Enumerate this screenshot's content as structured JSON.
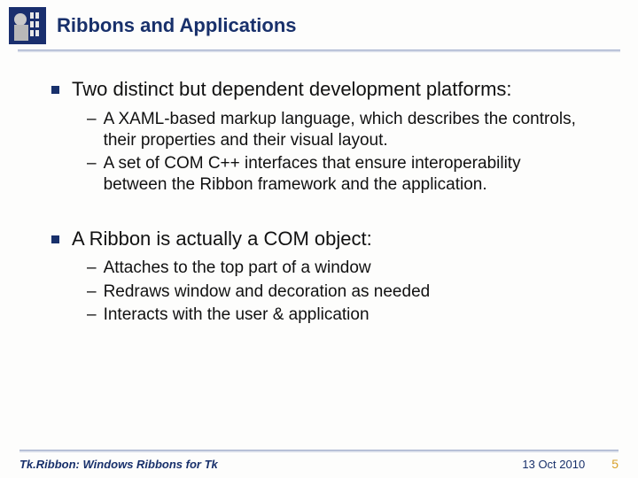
{
  "header": {
    "title": "Ribbons and Applications"
  },
  "bullets": [
    {
      "text": "Two distinct but dependent development platforms:",
      "subs": [
        "A XAML-based markup language, which describes the controls, their properties and their visual layout.",
        "A set of COM C++ interfaces that ensure interoperability between the Ribbon framework and the application."
      ]
    },
    {
      "text": "A Ribbon is actually a COM object:",
      "subs": [
        "Attaches to the top part of a window",
        "Redraws window and decoration as needed",
        "Interacts with the user & application"
      ]
    }
  ],
  "footer": {
    "left": "Tk.Ribbon: Windows Ribbons for Tk",
    "date": "13 Oct 2010",
    "page": "5"
  }
}
